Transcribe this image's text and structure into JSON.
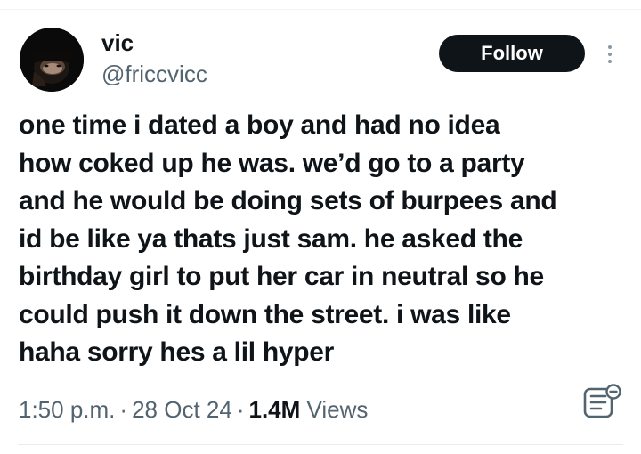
{
  "author": {
    "display_name": "vic",
    "handle": "@friccvicc"
  },
  "actions": {
    "follow_label": "Follow",
    "more_icon": "more-options-icon"
  },
  "tweet": {
    "lines": [
      "one time i dated a boy and had no idea",
      "how coked up he was. we’d go to a party",
      "and he would be doing sets of burpees and",
      "id be like ya thats just sam. he asked the",
      "birthday girl to put her car in neutral so he",
      "could push it down the street. i was like",
      "haha sorry hes a lil hyper"
    ]
  },
  "meta": {
    "time": "1:50 p.m.",
    "separator": "·",
    "date": "28 Oct 24",
    "views_count": "1.4M",
    "views_label": "Views",
    "notes_icon": "community-notes-icon"
  },
  "colors": {
    "text_primary": "#0f1419",
    "text_secondary": "#536471",
    "button_bg": "#0f1419",
    "button_text": "#ffffff",
    "divider": "#eff3f4"
  }
}
